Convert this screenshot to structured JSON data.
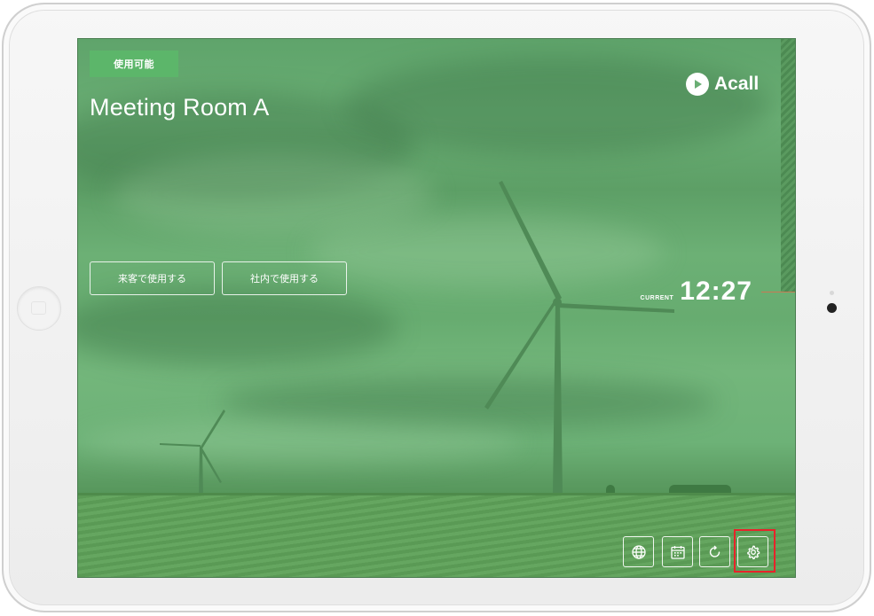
{
  "room": {
    "status": "使用可能",
    "name": "Meeting Room A"
  },
  "brand": {
    "name": "Acall",
    "icon": "play-logo-icon"
  },
  "actions": {
    "guest_label": "来客で使用する",
    "internal_label": "社内で使用する"
  },
  "clock": {
    "label": "CURRENT",
    "time": "12:27"
  },
  "toolbar": [
    {
      "icon": "globe-icon"
    },
    {
      "icon": "calendar-icon"
    },
    {
      "icon": "refresh-icon"
    },
    {
      "icon": "gear-icon",
      "highlighted": true
    }
  ],
  "colors": {
    "status_badge": "#5cb66a",
    "overlay_green": "#6aae74",
    "highlight": "#e8232a"
  }
}
